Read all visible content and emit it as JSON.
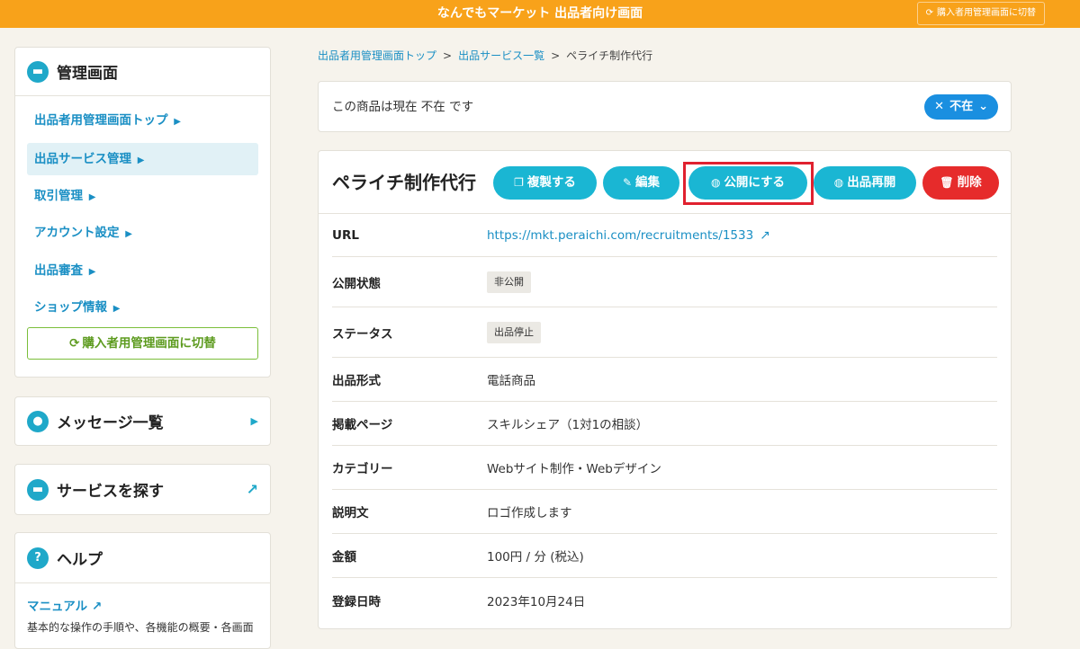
{
  "topbar": {
    "title": "なんでもマーケット 出品者向け画面",
    "switch_label": "購入者用管理画面に切替"
  },
  "sidebar": {
    "admin_title": "管理画面",
    "menu": [
      {
        "label": "出品者用管理画面トップ",
        "active": false
      },
      {
        "label": "出品サービス管理",
        "active": true
      },
      {
        "label": "取引管理",
        "active": false
      },
      {
        "label": "アカウント設定",
        "active": false
      },
      {
        "label": "出品審査",
        "active": false
      },
      {
        "label": "ショップ情報",
        "active": false
      }
    ],
    "switch_button": "購入者用管理画面に切替",
    "messages_title": "メッセージ一覧",
    "services_title": "サービスを探す",
    "help_title": "ヘルプ",
    "help_link": "マニュアル",
    "help_desc": "基本的な操作の手順や、各機能の概要・各画面"
  },
  "breadcrumb": {
    "items": [
      "出品者用管理画面トップ",
      "出品サービス一覧",
      "ペライチ制作代行"
    ],
    "separator": ">"
  },
  "status": {
    "text": "この商品は現在 不在 です",
    "dropdown_value": "不在"
  },
  "detail": {
    "title": "ペライチ制作代行",
    "buttons": {
      "duplicate": "複製する",
      "edit": "編集",
      "publish": "公開にする",
      "relist": "出品再開",
      "delete": "削除"
    },
    "rows": [
      {
        "label": "URL",
        "value": "https://mkt.peraichi.com/recruitments/1533"
      },
      {
        "label": "公開状態",
        "value": "非公開"
      },
      {
        "label": "ステータス",
        "value": "出品停止"
      },
      {
        "label": "出品形式",
        "value": "電話商品"
      },
      {
        "label": "掲載ページ",
        "value": "スキルシェア（1対1の相談）"
      },
      {
        "label": "カテゴリー",
        "value": "Webサイト制作・Webデザイン"
      },
      {
        "label": "説明文",
        "value": "ロゴ作成します"
      },
      {
        "label": "金額",
        "value": "100円 / 分 (税込)"
      },
      {
        "label": "登録日時",
        "value": "2023年10月24日"
      }
    ]
  },
  "colors": {
    "topbar": "#f8a21a",
    "accent": "#1ab6d3",
    "link": "#1a8fc4",
    "danger": "#e62b2b",
    "dropdown": "#1a8fe0",
    "switch_green": "#5d9b1f"
  }
}
